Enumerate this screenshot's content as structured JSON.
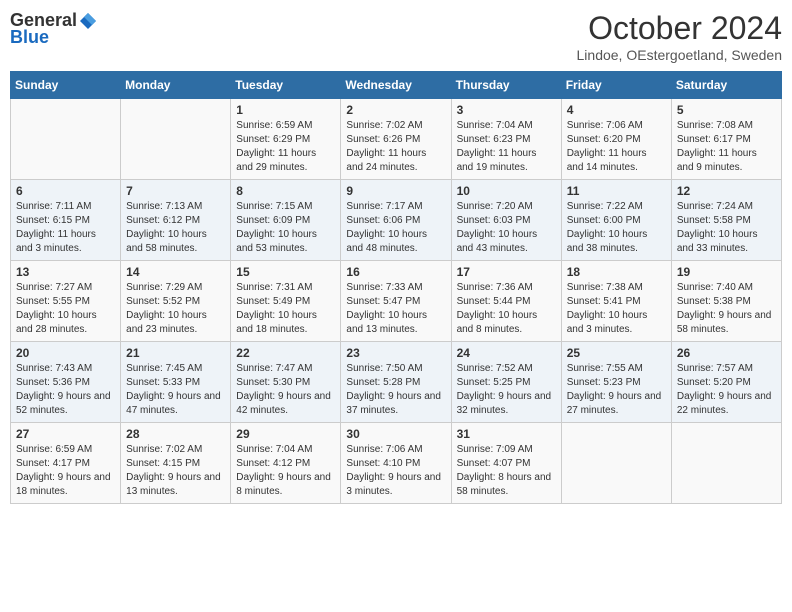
{
  "logo": {
    "general": "General",
    "blue": "Blue"
  },
  "title": "October 2024",
  "location": "Lindoe, OEstergoetland, Sweden",
  "days_of_week": [
    "Sunday",
    "Monday",
    "Tuesday",
    "Wednesday",
    "Thursday",
    "Friday",
    "Saturday"
  ],
  "weeks": [
    [
      null,
      null,
      {
        "day": "1",
        "sunrise": "Sunrise: 6:59 AM",
        "sunset": "Sunset: 6:29 PM",
        "daylight": "Daylight: 11 hours and 29 minutes."
      },
      {
        "day": "2",
        "sunrise": "Sunrise: 7:02 AM",
        "sunset": "Sunset: 6:26 PM",
        "daylight": "Daylight: 11 hours and 24 minutes."
      },
      {
        "day": "3",
        "sunrise": "Sunrise: 7:04 AM",
        "sunset": "Sunset: 6:23 PM",
        "daylight": "Daylight: 11 hours and 19 minutes."
      },
      {
        "day": "4",
        "sunrise": "Sunrise: 7:06 AM",
        "sunset": "Sunset: 6:20 PM",
        "daylight": "Daylight: 11 hours and 14 minutes."
      },
      {
        "day": "5",
        "sunrise": "Sunrise: 7:08 AM",
        "sunset": "Sunset: 6:17 PM",
        "daylight": "Daylight: 11 hours and 9 minutes."
      }
    ],
    [
      {
        "day": "6",
        "sunrise": "Sunrise: 7:11 AM",
        "sunset": "Sunset: 6:15 PM",
        "daylight": "Daylight: 11 hours and 3 minutes."
      },
      {
        "day": "7",
        "sunrise": "Sunrise: 7:13 AM",
        "sunset": "Sunset: 6:12 PM",
        "daylight": "Daylight: 10 hours and 58 minutes."
      },
      {
        "day": "8",
        "sunrise": "Sunrise: 7:15 AM",
        "sunset": "Sunset: 6:09 PM",
        "daylight": "Daylight: 10 hours and 53 minutes."
      },
      {
        "day": "9",
        "sunrise": "Sunrise: 7:17 AM",
        "sunset": "Sunset: 6:06 PM",
        "daylight": "Daylight: 10 hours and 48 minutes."
      },
      {
        "day": "10",
        "sunrise": "Sunrise: 7:20 AM",
        "sunset": "Sunset: 6:03 PM",
        "daylight": "Daylight: 10 hours and 43 minutes."
      },
      {
        "day": "11",
        "sunrise": "Sunrise: 7:22 AM",
        "sunset": "Sunset: 6:00 PM",
        "daylight": "Daylight: 10 hours and 38 minutes."
      },
      {
        "day": "12",
        "sunrise": "Sunrise: 7:24 AM",
        "sunset": "Sunset: 5:58 PM",
        "daylight": "Daylight: 10 hours and 33 minutes."
      }
    ],
    [
      {
        "day": "13",
        "sunrise": "Sunrise: 7:27 AM",
        "sunset": "Sunset: 5:55 PM",
        "daylight": "Daylight: 10 hours and 28 minutes."
      },
      {
        "day": "14",
        "sunrise": "Sunrise: 7:29 AM",
        "sunset": "Sunset: 5:52 PM",
        "daylight": "Daylight: 10 hours and 23 minutes."
      },
      {
        "day": "15",
        "sunrise": "Sunrise: 7:31 AM",
        "sunset": "Sunset: 5:49 PM",
        "daylight": "Daylight: 10 hours and 18 minutes."
      },
      {
        "day": "16",
        "sunrise": "Sunrise: 7:33 AM",
        "sunset": "Sunset: 5:47 PM",
        "daylight": "Daylight: 10 hours and 13 minutes."
      },
      {
        "day": "17",
        "sunrise": "Sunrise: 7:36 AM",
        "sunset": "Sunset: 5:44 PM",
        "daylight": "Daylight: 10 hours and 8 minutes."
      },
      {
        "day": "18",
        "sunrise": "Sunrise: 7:38 AM",
        "sunset": "Sunset: 5:41 PM",
        "daylight": "Daylight: 10 hours and 3 minutes."
      },
      {
        "day": "19",
        "sunrise": "Sunrise: 7:40 AM",
        "sunset": "Sunset: 5:38 PM",
        "daylight": "Daylight: 9 hours and 58 minutes."
      }
    ],
    [
      {
        "day": "20",
        "sunrise": "Sunrise: 7:43 AM",
        "sunset": "Sunset: 5:36 PM",
        "daylight": "Daylight: 9 hours and 52 minutes."
      },
      {
        "day": "21",
        "sunrise": "Sunrise: 7:45 AM",
        "sunset": "Sunset: 5:33 PM",
        "daylight": "Daylight: 9 hours and 47 minutes."
      },
      {
        "day": "22",
        "sunrise": "Sunrise: 7:47 AM",
        "sunset": "Sunset: 5:30 PM",
        "daylight": "Daylight: 9 hours and 42 minutes."
      },
      {
        "day": "23",
        "sunrise": "Sunrise: 7:50 AM",
        "sunset": "Sunset: 5:28 PM",
        "daylight": "Daylight: 9 hours and 37 minutes."
      },
      {
        "day": "24",
        "sunrise": "Sunrise: 7:52 AM",
        "sunset": "Sunset: 5:25 PM",
        "daylight": "Daylight: 9 hours and 32 minutes."
      },
      {
        "day": "25",
        "sunrise": "Sunrise: 7:55 AM",
        "sunset": "Sunset: 5:23 PM",
        "daylight": "Daylight: 9 hours and 27 minutes."
      },
      {
        "day": "26",
        "sunrise": "Sunrise: 7:57 AM",
        "sunset": "Sunset: 5:20 PM",
        "daylight": "Daylight: 9 hours and 22 minutes."
      }
    ],
    [
      {
        "day": "27",
        "sunrise": "Sunrise: 6:59 AM",
        "sunset": "Sunset: 4:17 PM",
        "daylight": "Daylight: 9 hours and 18 minutes."
      },
      {
        "day": "28",
        "sunrise": "Sunrise: 7:02 AM",
        "sunset": "Sunset: 4:15 PM",
        "daylight": "Daylight: 9 hours and 13 minutes."
      },
      {
        "day": "29",
        "sunrise": "Sunrise: 7:04 AM",
        "sunset": "Sunset: 4:12 PM",
        "daylight": "Daylight: 9 hours and 8 minutes."
      },
      {
        "day": "30",
        "sunrise": "Sunrise: 7:06 AM",
        "sunset": "Sunset: 4:10 PM",
        "daylight": "Daylight: 9 hours and 3 minutes."
      },
      {
        "day": "31",
        "sunrise": "Sunrise: 7:09 AM",
        "sunset": "Sunset: 4:07 PM",
        "daylight": "Daylight: 8 hours and 58 minutes."
      },
      null,
      null
    ]
  ]
}
